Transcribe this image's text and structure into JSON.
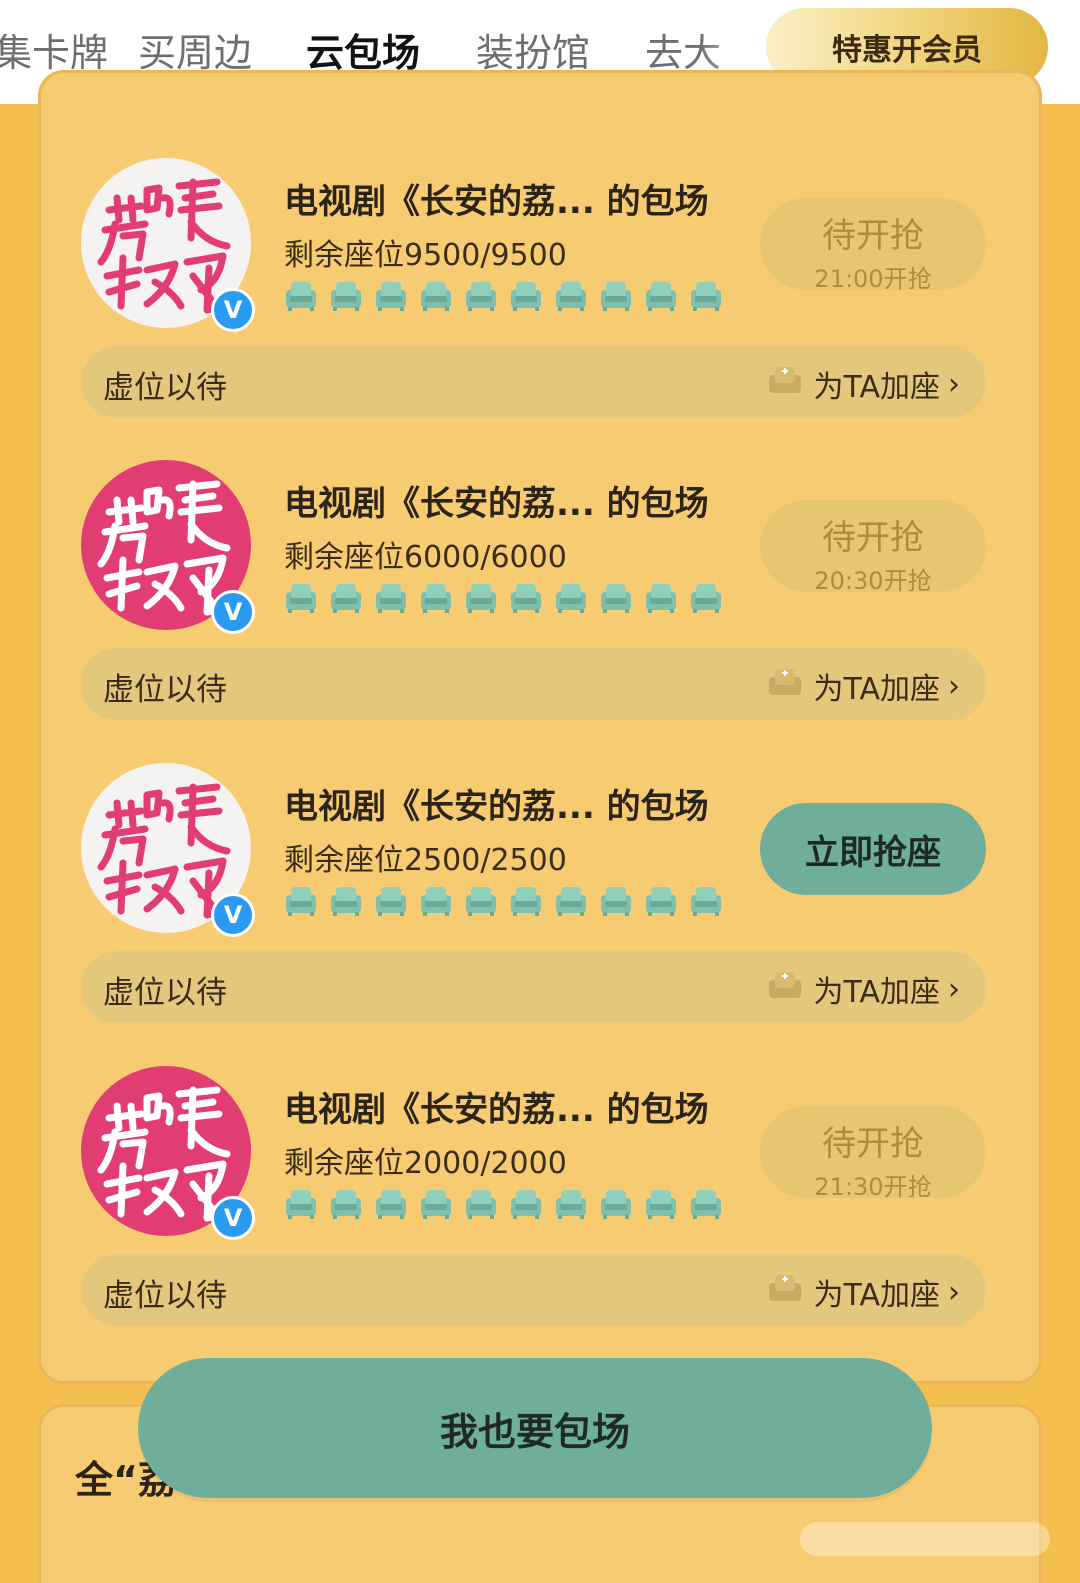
{
  "tabs": [
    "集卡牌",
    "买周边",
    "云包场",
    "装扮馆",
    "去大"
  ],
  "active_tab": "云包场",
  "vip_button": "特惠开会员",
  "avatar_text": "的荔長枝安",
  "sessions": [
    {
      "avatar_style": "light",
      "title": "电视剧《长安的荔... 的包场",
      "remaining": "剩余座位9500/9500",
      "button_state": "waiting",
      "button_label": "待开抢",
      "button_time": "21:00开抢",
      "seat_label": "虚位以待",
      "add_seat": "为TA加座"
    },
    {
      "avatar_style": "pink",
      "title": "电视剧《长安的荔... 的包场",
      "remaining": "剩余座位6000/6000",
      "button_state": "waiting",
      "button_label": "待开抢",
      "button_time": "20:30开抢",
      "seat_label": "虚位以待",
      "add_seat": "为TA加座"
    },
    {
      "avatar_style": "light",
      "title": "电视剧《长安的荔... 的包场",
      "remaining": "剩余座位2500/2500",
      "button_state": "open",
      "button_label": "立即抢座",
      "button_time": "",
      "seat_label": "虚位以待",
      "add_seat": "为TA加座"
    },
    {
      "avatar_style": "pink",
      "title": "电视剧《长安的荔... 的包场",
      "remaining": "剩余座位2000/2000",
      "button_state": "waiting",
      "button_label": "待开抢",
      "button_time": "21:30开抢",
      "seat_label": "虚位以待",
      "add_seat": "为TA加座"
    }
  ],
  "bottom_button": "我也要包场",
  "section2_title": "全“荔",
  "colors": {
    "background": "#f4bf4f",
    "panel": "#f7cb72",
    "teal": "#6fae9a",
    "pink": "#e23d72",
    "verified_badge": "#2a9bf0"
  },
  "icons": [
    "seat-icon",
    "add-seat-icon",
    "chevron-right-icon",
    "verified-badge-icon"
  ]
}
